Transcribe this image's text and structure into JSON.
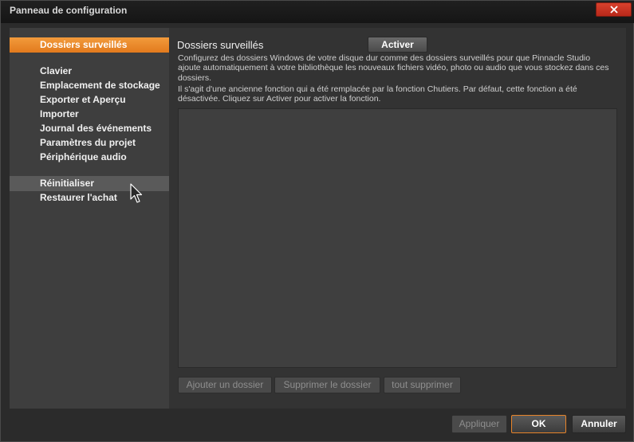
{
  "window": {
    "title": "Panneau de configuration"
  },
  "sidebar": {
    "items": [
      {
        "label": "Dossiers surveillés"
      },
      {
        "label": "Clavier"
      },
      {
        "label": "Emplacement de stockage"
      },
      {
        "label": "Exporter et Aperçu"
      },
      {
        "label": "Importer"
      },
      {
        "label": "Journal des événements"
      },
      {
        "label": "Paramètres du projet"
      },
      {
        "label": "Périphérique audio"
      },
      {
        "label": "Réinitialiser"
      },
      {
        "label": "Restaurer l'achat"
      }
    ]
  },
  "main": {
    "heading": "Dossiers surveillés",
    "activate_label": "Activer",
    "description_1": "Configurez des dossiers Windows de votre disque dur comme des dossiers surveillés pour que Pinnacle Studio ajoute automatiquement à votre bibliothèque les nouveaux fichiers vidéo, photo ou audio que vous stockez dans ces dossiers.",
    "description_2": "Il s'agit d'une ancienne fonction qui a été remplacée par la fonction Chutiers. Par défaut, cette fonction a été désactivée. Cliquez sur Activer pour activer la fonction.",
    "add_folder_label": "Ajouter un dossier",
    "remove_folder_label": "Supprimer le dossier",
    "remove_all_label": "tout supprimer"
  },
  "footer": {
    "apply_label": "Appliquer",
    "ok_label": "OK",
    "cancel_label": "Annuler"
  },
  "colors": {
    "accent": "#e8842a",
    "close": "#c8321f"
  }
}
